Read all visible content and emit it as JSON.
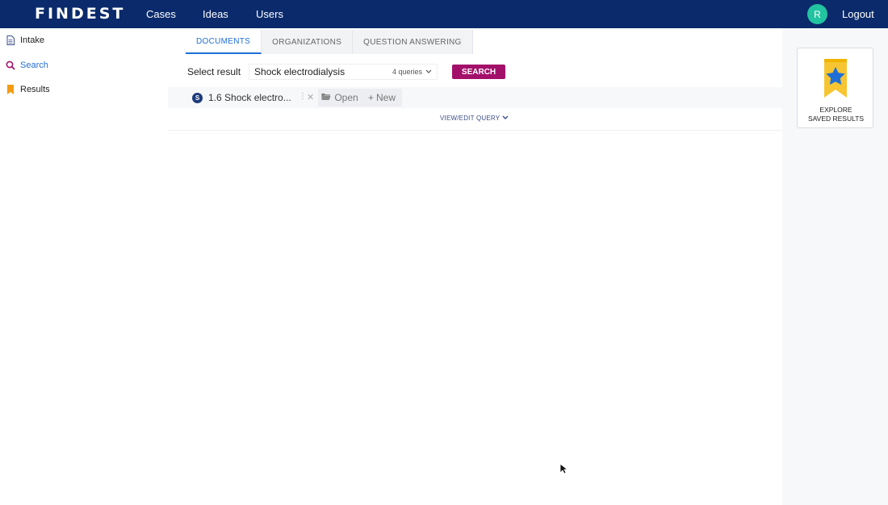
{
  "header": {
    "logo": "FINDEST",
    "nav": [
      "Cases",
      "Ideas",
      "Users"
    ],
    "avatar_initial": "R",
    "logout_label": "Logout"
  },
  "sidebar": {
    "items": [
      {
        "label": "Intake",
        "icon": "document-icon"
      },
      {
        "label": "Search",
        "icon": "search-icon",
        "active": true
      },
      {
        "label": "Results",
        "icon": "bookmark-icon"
      }
    ]
  },
  "main": {
    "tabs": [
      {
        "label": "DOCUMENTS",
        "active": true
      },
      {
        "label": "ORGANIZATIONS"
      },
      {
        "label": "QUESTION ANSWERING"
      }
    ],
    "select": {
      "label": "Select result",
      "value": "Shock electrodialysis",
      "queries": "4 queries",
      "search_button": "SEARCH"
    },
    "query": {
      "badge": "S",
      "title": "1.6 Shock electro...",
      "open_label": "Open",
      "new_label": "New"
    },
    "view_edit_label": "VIEW/EDIT QUERY"
  },
  "saved_results": {
    "line1": "EXPLORE",
    "line2": "SAVED RESULTS"
  },
  "colors": {
    "header_bg": "#0a2a6b",
    "accent_blue": "#1f6fd6",
    "search_button": "#a3106a",
    "avatar": "#22c3a0"
  }
}
